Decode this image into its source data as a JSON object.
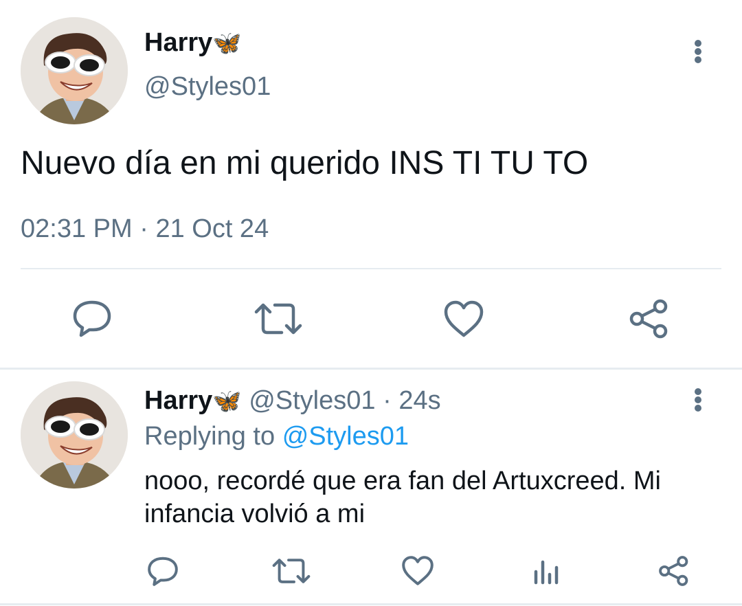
{
  "main_tweet": {
    "author_name": "Harry",
    "author_emoji": "🦋",
    "handle": "@Styles01",
    "text": "Nuevo día en mi querido INS TI TU TO",
    "time": "02:31 PM",
    "separator": "·",
    "date": "21 Oct 24"
  },
  "reply": {
    "author_name": "Harry",
    "author_emoji": "🦋",
    "handle": "@Styles01",
    "separator": "·",
    "age": "24s",
    "replying_prefix": "Replying to",
    "replying_handle": "@Styles01",
    "text_line1": "nooo, recordé que era fan del Artuxcreed. Mi",
    "text_line2": "infancia volvió a mi"
  },
  "icons": {
    "reply": "reply-icon",
    "retweet": "retweet-icon",
    "like": "like-icon",
    "share": "share-icon",
    "analytics": "analytics-icon",
    "more": "more-vertical-icon"
  },
  "colors": {
    "text": "#0f1419",
    "muted": "#5b7083",
    "link": "#1d9bf0",
    "divider": "#e6ecf0",
    "butterfly": "#e8891a"
  }
}
